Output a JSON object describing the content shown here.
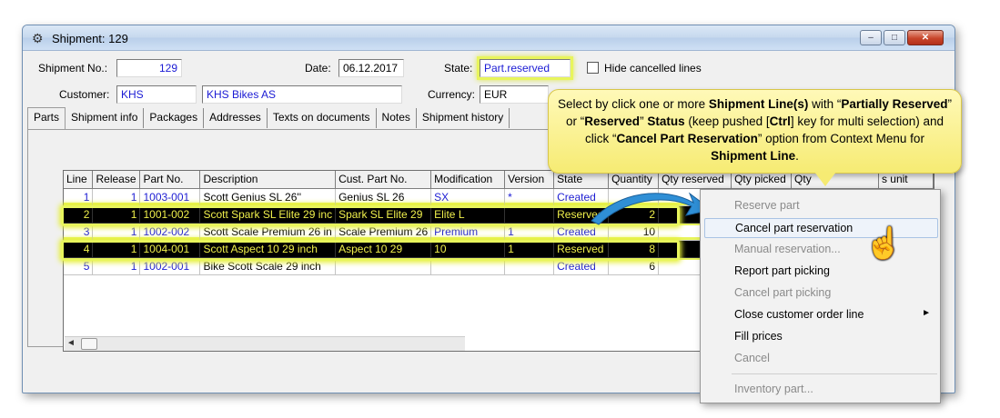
{
  "window": {
    "title": "Shipment: 129",
    "min": "–",
    "max": "□",
    "close": "✕"
  },
  "header": {
    "shipment_no_label": "Shipment No.:",
    "shipment_no": "129",
    "date_label": "Date:",
    "date": "06.12.2017",
    "state_label": "State:",
    "state": "Part.reserved",
    "hide_cancelled_label": "Hide cancelled lines",
    "customer_label": "Customer:",
    "customer_code": "KHS",
    "customer_name": "KHS Bikes AS",
    "currency_label": "Currency:",
    "currency": "EUR"
  },
  "tabs": [
    "Parts",
    "Shipment info",
    "Packages",
    "Addresses",
    "Texts on documents",
    "Notes",
    "Shipment history"
  ],
  "grid": {
    "columns": [
      "Line",
      "Release",
      "Part No.",
      "Description",
      "Cust. Part No.",
      "Modification",
      "Version",
      "State",
      "Quantity",
      "Qty reserved",
      "Qty picked",
      "Qty",
      "s unit"
    ],
    "rows": [
      {
        "line": "1",
        "release": "1",
        "part": "1003-001",
        "desc": "Scott Genius SL 26''",
        "cust": "Genius SL 26",
        "mod": "SX",
        "ver": "*",
        "state": "Created",
        "qty": ""
      },
      {
        "line": "2",
        "release": "1",
        "part": "1001-002",
        "desc": "Scott Spark SL Elite 29 inc",
        "cust": "Spark SL Elite 29",
        "mod": "Elite L",
        "ver": "",
        "state": "Reserved",
        "qty": "2"
      },
      {
        "line": "3",
        "release": "1",
        "part": "1002-002",
        "desc": "Scott Scale Premium 26 in",
        "cust": "Scale Premium 26",
        "mod": "Premium",
        "ver": "1",
        "state": "Created",
        "qty": "10"
      },
      {
        "line": "4",
        "release": "1",
        "part": "1004-001",
        "desc": "Scott Aspect 10 29 inch",
        "cust": "Aspect 10 29",
        "mod": "10",
        "ver": "1",
        "state": "Reserved",
        "qty": "8"
      },
      {
        "line": "5",
        "release": "1",
        "part": "1002-001",
        "desc": "Bike Scott Scale 29 inch",
        "cust": "",
        "mod": "",
        "ver": "",
        "state": "Created",
        "qty": "6"
      }
    ]
  },
  "callout": {
    "p1": "Select by click one or more ",
    "b1": "Shipment Line(s)",
    "p2": " with “",
    "b2": "Partially Reserved",
    "p3": "” or “",
    "b3": "Reserved",
    "p4": "” ",
    "b4": "Status",
    "p5": " (keep pushed [",
    "b5": "Ctrl",
    "p6": "] key for multi selection) and click “",
    "b6": "Cancel Part Reservation",
    "p7": "” option from Context Menu for ",
    "b7": "Shipment Line",
    "p8": "."
  },
  "context_menu": {
    "reserve_part": "Reserve part",
    "cancel_part_reservation": "Cancel part reservation",
    "manual_reservation": "Manual reservation...",
    "report_part_picking": "Report part picking",
    "cancel_part_picking": "Cancel part picking",
    "close_customer_order_line": "Close customer order line",
    "fill_prices": "Fill prices",
    "cancel": "Cancel",
    "inventory_part": "Inventory part..."
  },
  "colors": {
    "link_blue": "#1a1ad4",
    "highlight_yellow": "#e8f55c",
    "selection": "#000000"
  }
}
